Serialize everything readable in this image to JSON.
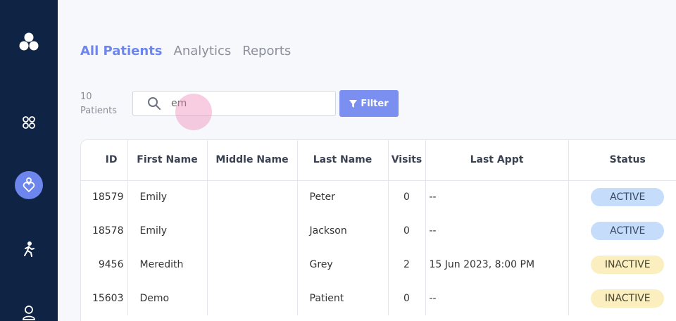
{
  "tabs": [
    {
      "label": "All Patients",
      "active": true
    },
    {
      "label": "Analytics",
      "active": false
    },
    {
      "label": "Reports",
      "active": false
    }
  ],
  "patient_count": {
    "number": "10",
    "label": "Patients"
  },
  "search": {
    "value": "em",
    "placeholder": ""
  },
  "filter_button": {
    "label": "Filter"
  },
  "sidebar": {
    "icons": [
      "logo-icon",
      "dashboard-icon",
      "patients-icon",
      "activity-icon",
      "profile-icon"
    ]
  },
  "table": {
    "headers": [
      "ID",
      "First Name",
      "Middle Name",
      "Last Name",
      "Visits",
      "Last Appt",
      "Status"
    ],
    "rows": [
      {
        "id": "18579",
        "first": "Emily",
        "middle": "",
        "last": "Peter",
        "visits": "0",
        "appt": "--",
        "status": "ACTIVE"
      },
      {
        "id": "18578",
        "first": "Emily",
        "middle": "",
        "last": "Jackson",
        "visits": "0",
        "appt": "--",
        "status": "ACTIVE"
      },
      {
        "id": "9456",
        "first": "Meredith",
        "middle": "",
        "last": "Grey",
        "visits": "2",
        "appt": "15 Jun 2023, 8:00 PM",
        "status": "INACTIVE"
      },
      {
        "id": "15603",
        "first": "Demo",
        "middle": "",
        "last": "Patient",
        "visits": "0",
        "appt": "--",
        "status": "INACTIVE"
      }
    ]
  },
  "colors": {
    "sidebar": "#0f2344",
    "accent": "#6d86ee",
    "active_badge": "#c5dcfa",
    "inactive_badge": "#fbefbf"
  }
}
